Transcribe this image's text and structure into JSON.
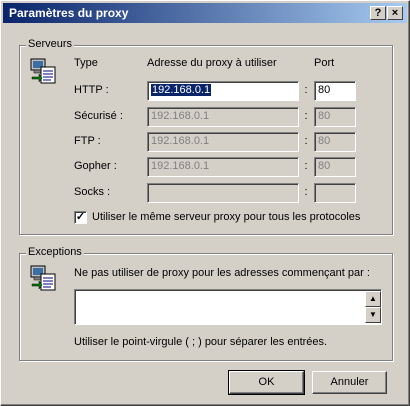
{
  "window": {
    "title": "Paramètres du proxy",
    "help_btn": "?",
    "close_btn": "×"
  },
  "servers": {
    "legend": "Serveurs",
    "col_type": "Type",
    "col_address": "Adresse du proxy à utiliser",
    "col_port": "Port",
    "rows": [
      {
        "label": "HTTP :",
        "address": "192.168.0.1",
        "port": "80",
        "enabled": true
      },
      {
        "label": "Sécurisé :",
        "address": "192.168.0.1",
        "port": "80",
        "enabled": false
      },
      {
        "label": "FTP :",
        "address": "192.168.0.1",
        "port": "80",
        "enabled": false
      },
      {
        "label": "Gopher :",
        "address": "192.168.0.1",
        "port": "80",
        "enabled": false
      },
      {
        "label": "Socks :",
        "address": "",
        "port": "",
        "enabled": false
      }
    ],
    "colon": ":",
    "same_proxy_label": "Utiliser le même serveur proxy pour tous les protocoles",
    "same_proxy_checked": true
  },
  "exceptions": {
    "legend": "Exceptions",
    "desc": "Ne pas utiliser de proxy pour les adresses commençant par :",
    "value": "",
    "note": "Utiliser le point-virgule ( ; ) pour séparer les entrées."
  },
  "buttons": {
    "ok": "OK",
    "cancel": "Annuler"
  },
  "icons": {
    "servers": "network-computer-icon",
    "exceptions": "network-computer-icon"
  },
  "colors": {
    "title_start": "#0a246a",
    "title_end": "#a6caf0",
    "face": "#d4d0c8"
  }
}
